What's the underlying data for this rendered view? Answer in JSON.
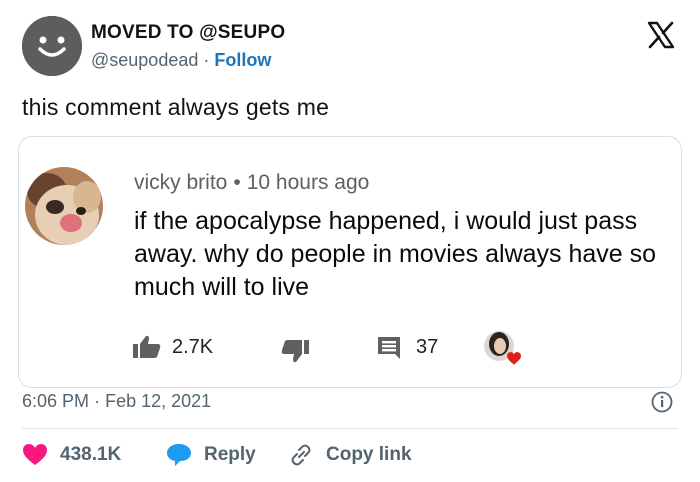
{
  "author": {
    "display_name": "MOVED TO @SEUPO",
    "handle": "@seupodead",
    "separator": "·",
    "follow_label": "Follow"
  },
  "tweet": {
    "text": "this comment always gets me",
    "time": "6:06 PM",
    "date_separator": "·",
    "date": "Feb 12, 2021"
  },
  "embedded_comment": {
    "author": "vicky brito",
    "separator": "•",
    "age": "10 hours ago",
    "body": "if the apocalypse happened, i would just pass away. why do people in movies always have so much will to live",
    "likes": "2.7K",
    "replies": "37"
  },
  "footer": {
    "like_count": "438.1K",
    "reply_label": "Reply",
    "copy_link_label": "Copy link"
  },
  "colors": {
    "heart": "#f91880",
    "reply_bubble": "#1d9bf0",
    "follow": "#1d74b8",
    "muted": "#536471"
  }
}
